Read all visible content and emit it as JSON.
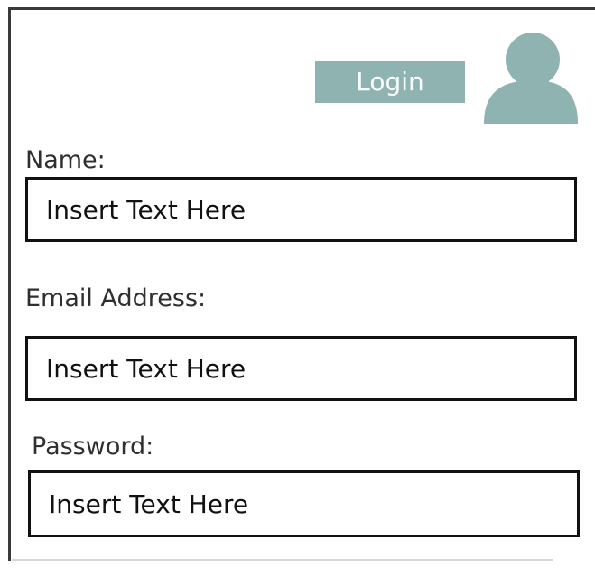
{
  "login": {
    "button_label": "Login",
    "button_color": "#8fb3b0"
  },
  "avatar": {
    "icon": "user-avatar-icon",
    "color": "#8fb3b0"
  },
  "form": {
    "name": {
      "label": "Name:",
      "value": "Insert Text Here"
    },
    "email": {
      "label": "Email Address:",
      "value": "Insert Text Here"
    },
    "password": {
      "label": "Password:",
      "value": "Insert Text Here"
    }
  }
}
